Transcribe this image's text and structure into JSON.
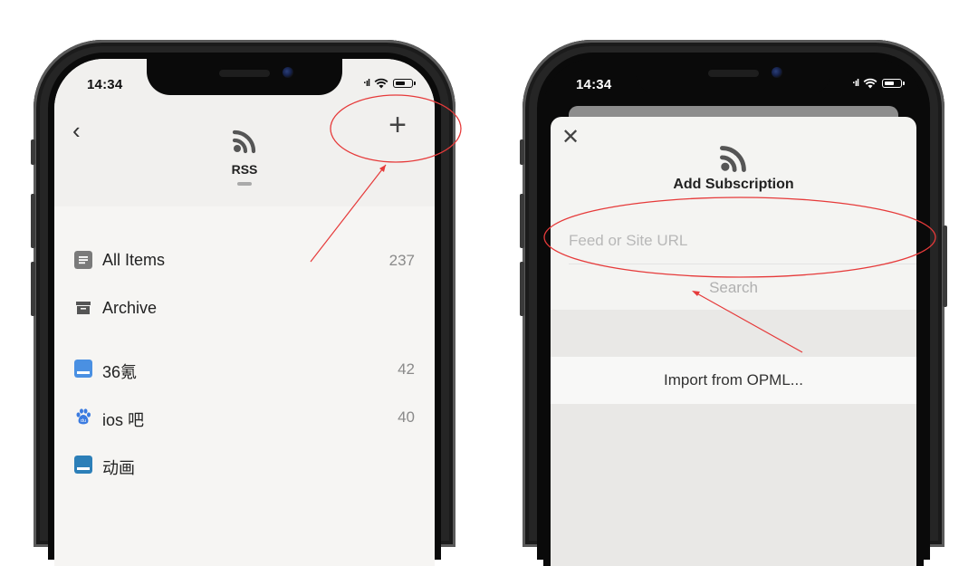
{
  "left_phone": {
    "status_time": "14:34",
    "header_title": "RSS",
    "items": [
      {
        "label": "All Items",
        "count": "237",
        "icon": "list-icon",
        "color": "#7a7a7a"
      },
      {
        "label": "Archive",
        "count": "",
        "icon": "archive-icon",
        "color": "#555555"
      },
      {
        "label": "36氪",
        "count": "42",
        "icon": "feed-36kr-icon",
        "color": "#4a90e2"
      },
      {
        "label": "ios 吧",
        "count": "40",
        "icon": "baidu-paw-icon",
        "color": "#3b7be0"
      },
      {
        "label": "动画",
        "count": "",
        "icon": "feed-donghua-icon",
        "color": "#2c7fb8"
      }
    ]
  },
  "right_phone": {
    "status_time": "14:34",
    "sheet_title": "Add Subscription",
    "url_placeholder": "Feed or Site URL",
    "search_label": "Search",
    "import_label": "Import from OPML..."
  },
  "colors": {
    "annotation_red": "#e63a3a",
    "rss_icon": "#555555"
  }
}
